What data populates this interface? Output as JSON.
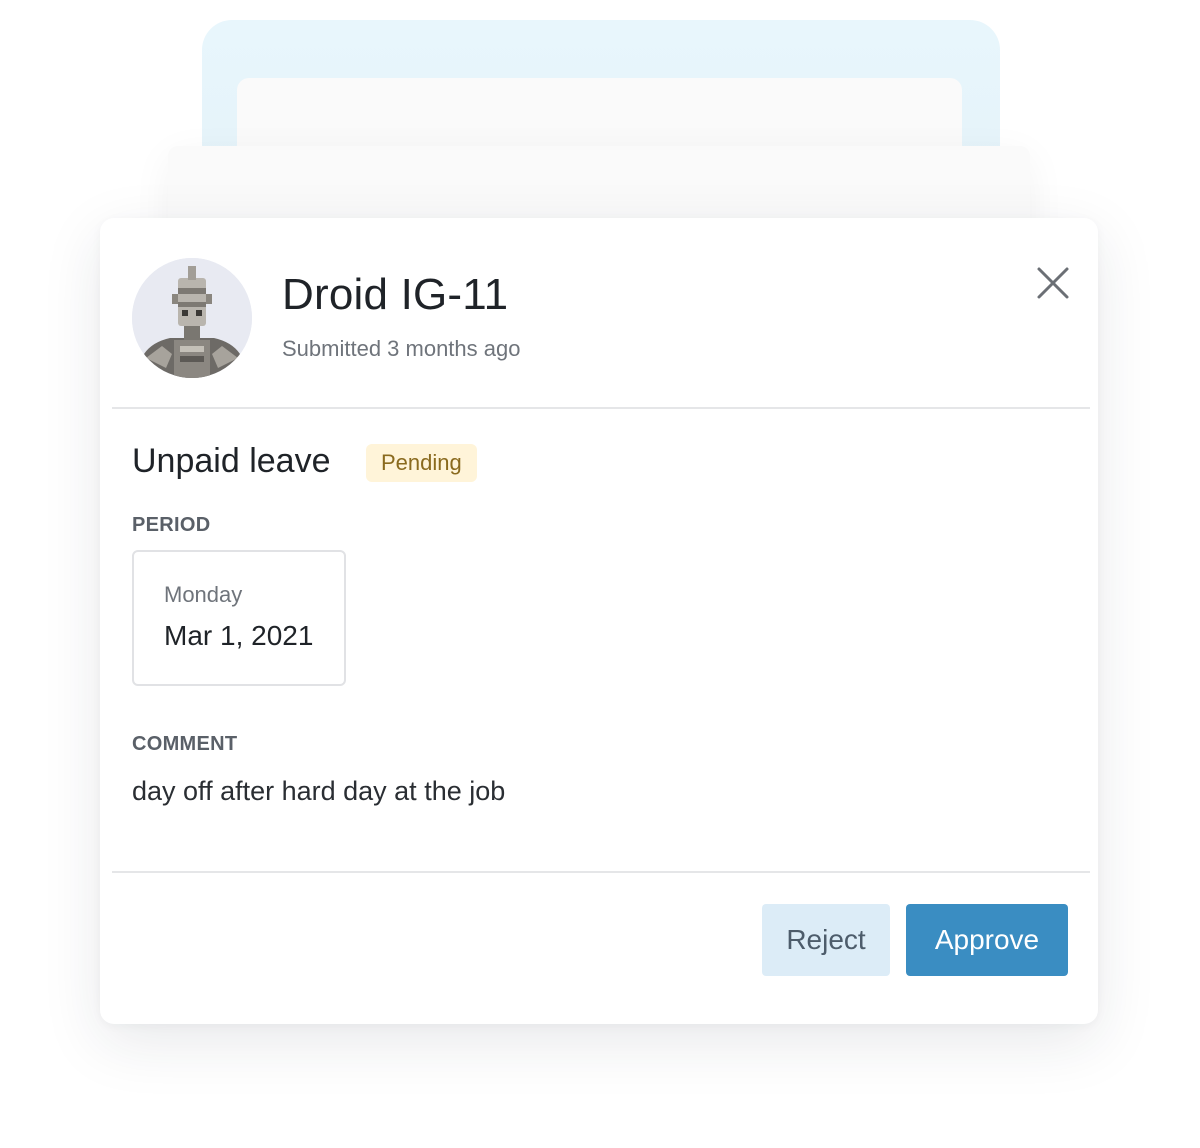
{
  "request": {
    "user_name": "Droid IG-11",
    "submitted": "Submitted 3 months ago",
    "leave_type": "Unpaid leave",
    "status": "Pending",
    "period_label": "PERIOD",
    "period_day": "Monday",
    "period_date": "Mar 1, 2021",
    "comment_label": "COMMENT",
    "comment": "day off after hard day at the job"
  },
  "actions": {
    "reject_label": "Reject",
    "approve_label": "Approve"
  },
  "icons": {
    "close": "close-icon",
    "avatar": "droid-avatar"
  },
  "colors": {
    "approve_bg": "#3a8dc2",
    "reject_bg": "#dcecf7",
    "pending_bg": "#fff4d9",
    "pending_text": "#8a6a1e",
    "stack_accent": "#e8f6fc"
  }
}
